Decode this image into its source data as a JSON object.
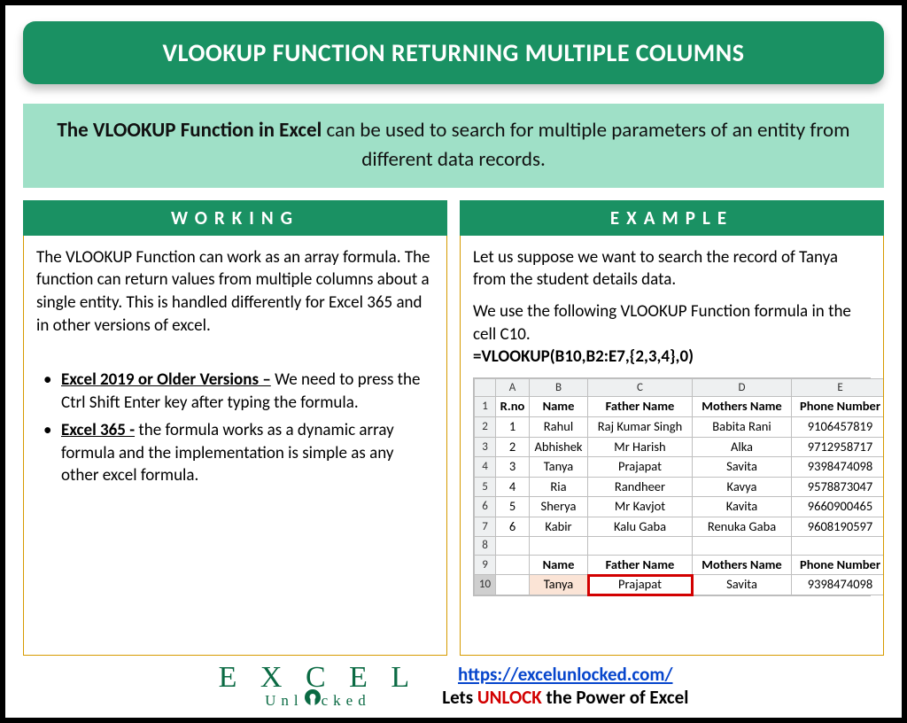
{
  "title": "VLOOKUP FUNCTION RETURNING MULTIPLE COLUMNS",
  "intro_bold": "The VLOOKUP Function in Excel",
  "intro_rest": " can be used to search for multiple parameters of an entity from different data records.",
  "working": {
    "header": "WORKING",
    "para": "The VLOOKUP Function can work as an array formula. The function can return values from multiple columns about a single entity. This is handled differently for Excel 365 and in other versions of excel.",
    "bullets": [
      {
        "lead": "Excel 2019 or Older Versions –",
        "rest": " We need to press the Ctrl Shift Enter key after typing the formula."
      },
      {
        "lead": "Excel 365 -",
        "rest": "  the formula works as a dynamic array formula and the implementation is simple as any other excel formula."
      }
    ]
  },
  "example": {
    "header": "EXAMPLE",
    "p1": "Let us suppose we want to search the record of Tanya from the student details data.",
    "p2": "We use the following VLOOKUP Function formula in the cell C10.",
    "formula": "=VLOOKUP(B10,B2:E7,{2,3,4},0)",
    "sheet": {
      "cols": [
        "A",
        "B",
        "C",
        "D",
        "E"
      ],
      "headers": [
        "R.no",
        "Name",
        "Father Name",
        "Mothers Name",
        "Phone Number"
      ],
      "rows": [
        [
          "1",
          "Rahul",
          "Raj Kumar Singh",
          "Babita Rani",
          "9106457819"
        ],
        [
          "2",
          "Abhishek",
          "Mr Harish",
          "Alka",
          "9712958717"
        ],
        [
          "3",
          "Tanya",
          "Prajapat",
          "Savita",
          "9398474098"
        ],
        [
          "4",
          "Ria",
          "Randheer",
          "Kavya",
          "9578873047"
        ],
        [
          "5",
          "Sherya",
          "Mr Kavjot",
          "Kavita",
          "9660900465"
        ],
        [
          "6",
          "Kabir",
          "Kalu Gaba",
          "Renuka Gaba",
          "9608190597"
        ]
      ],
      "lookup_headers": [
        "Name",
        "Father Name",
        "Mothers Name",
        "Phone Number"
      ],
      "lookup_row": [
        "Tanya",
        "Prajapat",
        "Savita",
        "9398474098"
      ],
      "lookup_rownum": "10",
      "blank_rownum": "8",
      "hdr_rownum": "9"
    }
  },
  "footer": {
    "logo_top_before": "E X",
    "logo_top_after": "C E L",
    "logo_bottom": "Unl cked",
    "url": "https://excelunlocked.com/",
    "tagline_a": "Lets ",
    "tagline_b": "UNLOCK",
    "tagline_c": " the Power of Excel"
  }
}
